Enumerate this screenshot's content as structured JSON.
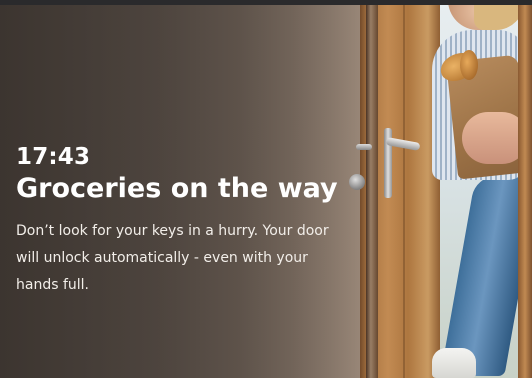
{
  "card": {
    "time": "17:43",
    "headline": "Groceries on the way",
    "body": "Don’t look for your keys in a hurry. Your door will unlock automatically - even with your hands full."
  },
  "theme": {
    "text_color": "#ffffff",
    "overlay_color": "#201a16"
  },
  "image": {
    "description_icon": "door-with-person-carrying-groceries-photo"
  }
}
